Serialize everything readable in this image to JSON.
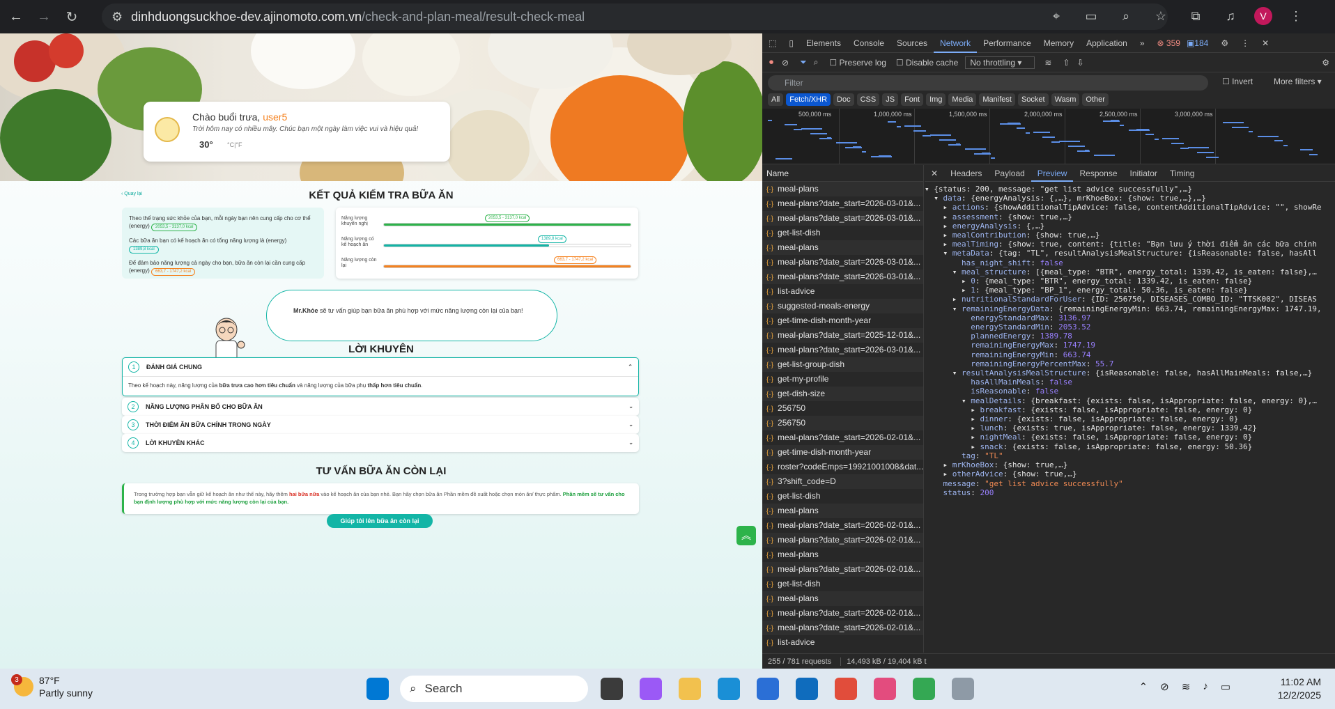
{
  "browser": {
    "url_host": "dinhduongsuckhoe-dev.ajinomoto.com.vn",
    "url_path": "/check-and-plan-meal/result-check-meal",
    "avatar_letter": "V"
  },
  "page": {
    "greeting": {
      "hello": "Chào buổi trưa, ",
      "user": "user5",
      "subtitle": "Trời hôm nay có nhiều mây. Chúc bạn một ngày làm việc vui và hiệu quả!",
      "temperature": "30°",
      "temp_unit": "°C|°F"
    },
    "back_label": "Quay lại",
    "result_title": "KẾT QUẢ KIỂM TRA BỮA ĂN",
    "summary": {
      "line1": "Theo thể trạng sức khỏe của bạn, mỗi ngày bạn nên cung cấp cho cơ thể (energy)",
      "line1_pill": "2053,5 - 3137,0 kcal",
      "line2": "Các bữa ăn bạn có kế hoạch ăn có tổng năng lượng là (energy)",
      "line2_pill": "1389,8 kcal",
      "line3": "Để đảm bảo năng lượng cả ngày cho bạn, bữa ăn còn lại cần cung cấp (energy)",
      "line3_pill": "663,7 - 1747,2 kcal"
    },
    "bars": [
      {
        "label": "Năng lượng khuyến nghị",
        "pill": "2053,5 - 3137,0 kcal",
        "fill_pct": 100,
        "color": "#2db34a"
      },
      {
        "label": "Năng lượng có kế hoạch ăn",
        "pill": "1389,8 kcal",
        "fill_pct": 67,
        "color": "#13b5a6"
      },
      {
        "label": "Năng lượng còn lại",
        "pill": "663,7 - 1747,2 kcal",
        "fill_pct": 100,
        "color": "#f5821f"
      }
    ],
    "mrkhoe": {
      "name": "Mr.Khỏe",
      "text": " sẽ tư vấn giúp bạn bữa ăn phù hợp với mức năng lượng còn lại của bạn!"
    },
    "advice_title": "LỜI KHUYÊN",
    "accordions": [
      {
        "num": "1",
        "title": "ĐÁNH GIÁ CHUNG",
        "open": true,
        "body_prefix": "Theo kế hoạch này, năng lượng của ",
        "body_b1": "bữa trưa cao hơn tiêu chuẩn",
        "body_mid": " và năng lượng của bữa phụ ",
        "body_b2": "thấp hơn tiêu chuẩn",
        "body_end": "."
      },
      {
        "num": "2",
        "title": "NĂNG LƯỢNG PHÂN BỐ CHO BỮA ĂN",
        "open": false
      },
      {
        "num": "3",
        "title": "THỜI ĐIỂM ĂN BỮA CHÍNH TRONG NGÀY",
        "open": false
      },
      {
        "num": "4",
        "title": "LỜI KHUYÊN KHÁC",
        "open": false
      }
    ],
    "remaining_title": "TƯ VẤN BỮA ĂN CÒN LẠI",
    "remaining": {
      "p1": "Trong trường hợp bạn vẫn giữ kế hoạch ăn như thế này, hãy thêm ",
      "red": "hai bữa nữa",
      "p2": " vào kế hoạch ăn của bạn nhé. Bạn hãy chọn bữa ăn Phần mềm đề xuất hoặc chọn món ăn/ thực phẩm. ",
      "green": "Phần mềm sẽ tư vấn cho bạn định lượng phù hợp với mức năng lượng còn lại của bạn."
    },
    "help_button": "Giúp tôi lên bữa ăn còn lại"
  },
  "devtools": {
    "tabs": [
      "Elements",
      "Console",
      "Sources",
      "Network",
      "Performance",
      "Memory",
      "Application"
    ],
    "active_tab": "Network",
    "errors": "359",
    "messages": "184",
    "preserve_log": "Preserve log",
    "disable_cache": "Disable cache",
    "throttling": "No throttling",
    "filter_placeholder": "Filter",
    "invert": "Invert",
    "more_filters": "More filters",
    "type_chips": [
      "All",
      "Fetch/XHR",
      "Doc",
      "CSS",
      "JS",
      "Font",
      "Img",
      "Media",
      "Manifest",
      "Socket",
      "Wasm",
      "Other"
    ],
    "active_chip": "Fetch/XHR",
    "timeline_labels": [
      "500,000 ms",
      "1,000,000 ms",
      "1,500,000 ms",
      "2,000,000 ms",
      "2,500,000 ms",
      "3,000,000 ms"
    ],
    "name_header": "Name",
    "requests": [
      "meal-plans",
      "meal-plans?date_start=2026-03-01&...",
      "meal-plans?date_start=2026-03-01&...",
      "get-list-dish",
      "meal-plans",
      "meal-plans?date_start=2026-03-01&...",
      "meal-plans?date_start=2026-03-01&...",
      "list-advice",
      "suggested-meals-energy",
      "get-time-dish-month-year",
      "meal-plans?date_start=2025-12-01&...",
      "meal-plans?date_start=2026-03-01&...",
      "get-list-group-dish",
      "get-my-profile",
      "get-dish-size",
      "256750",
      "256750",
      "meal-plans?date_start=2026-02-01&...",
      "get-time-dish-month-year",
      "roster?codeEmps=19921001008&dat...",
      "3?shift_code=D",
      "get-list-dish",
      "meal-plans",
      "meal-plans?date_start=2026-02-01&...",
      "meal-plans?date_start=2026-02-01&...",
      "meal-plans",
      "meal-plans?date_start=2026-02-01&...",
      "get-list-dish",
      "meal-plans",
      "meal-plans?date_start=2026-02-01&...",
      "meal-plans?date_start=2026-02-01&...",
      "list-advice"
    ],
    "status_text": "255 / 781 requests",
    "size_text": "14,493 kB / 19,404 kB t",
    "preview_tabs": [
      "Headers",
      "Payload",
      "Preview",
      "Response",
      "Initiator",
      "Timing"
    ],
    "active_preview_tab": "Preview",
    "tree": [
      "▾ {status: 200, message: \"get list advice successfully\",…}",
      "  ▾ data: {energyAnalysis: {,…}, mrKhoeBox: {show: true,…},…}",
      "    ▸ actions: {showAdditionalTipAdvice: false, contentAdditionalTipAdvice: \"\", showRe",
      "    ▸ assessment: {show: true,…}",
      "    ▸ energyAnalysis: {,…}",
      "    ▸ mealContribution: {show: true,…}",
      "    ▸ mealTiming: {show: true, content: {title: \"Bạn lưu ý thời điểm ăn các bữa chính",
      "    ▾ metaData: {tag: \"TL\", resultAnalysisMealStructure: {isReasonable: false, hasAll",
      "        has_night_shift: false",
      "      ▾ meal_structure: [{meal_type: \"BTR\", energy_total: 1339.42, is_eaten: false},…",
      "        ▸ 0: {meal_type: \"BTR\", energy_total: 1339.42, is_eaten: false}",
      "        ▸ 1: {meal_type: \"BP_1\", energy_total: 50.36, is_eaten: false}",
      "      ▸ nutritionalStandardForUser: {ID: 256750, DISEASES_COMBO_ID: \"TTSK002\", DISEAS",
      "      ▾ remainingEnergyData: {remainingEnergyMin: 663.74, remainingEnergyMax: 1747.19,",
      "          energyStandardMax: 3136.97",
      "          energyStandardMin: 2053.52",
      "          plannedEnergy: 1389.78",
      "          remainingEnergyMax: 1747.19",
      "          remainingEnergyMin: 663.74",
      "          remainingEnergyPercentMax: 55.7",
      "      ▾ resultAnalysisMealStructure: {isReasonable: false, hasAllMainMeals: false,…}",
      "          hasAllMainMeals: false",
      "          isReasonable: false",
      "        ▾ mealDetails: {breakfast: {exists: false, isAppropriate: false, energy: 0},…",
      "          ▸ breakfast: {exists: false, isAppropriate: false, energy: 0}",
      "          ▸ dinner: {exists: false, isAppropriate: false, energy: 0}",
      "          ▸ lunch: {exists: true, isAppropriate: false, energy: 1339.42}",
      "          ▸ nightMeal: {exists: false, isAppropriate: false, energy: 0}",
      "          ▸ snack: {exists: false, isAppropriate: false, energy: 50.36}",
      "        tag: \"TL\"",
      "    ▸ mrKhoeBox: {show: true,…}",
      "    ▸ otherAdvice: {show: true,…}",
      "    message: \"get list advice successfully\"",
      "    status: 200"
    ]
  },
  "taskbar": {
    "weather_badge": "3",
    "temp": "87°F",
    "condition": "Partly sunny",
    "search": "Search",
    "time": "11:02 AM",
    "date": "12/2/2025"
  }
}
